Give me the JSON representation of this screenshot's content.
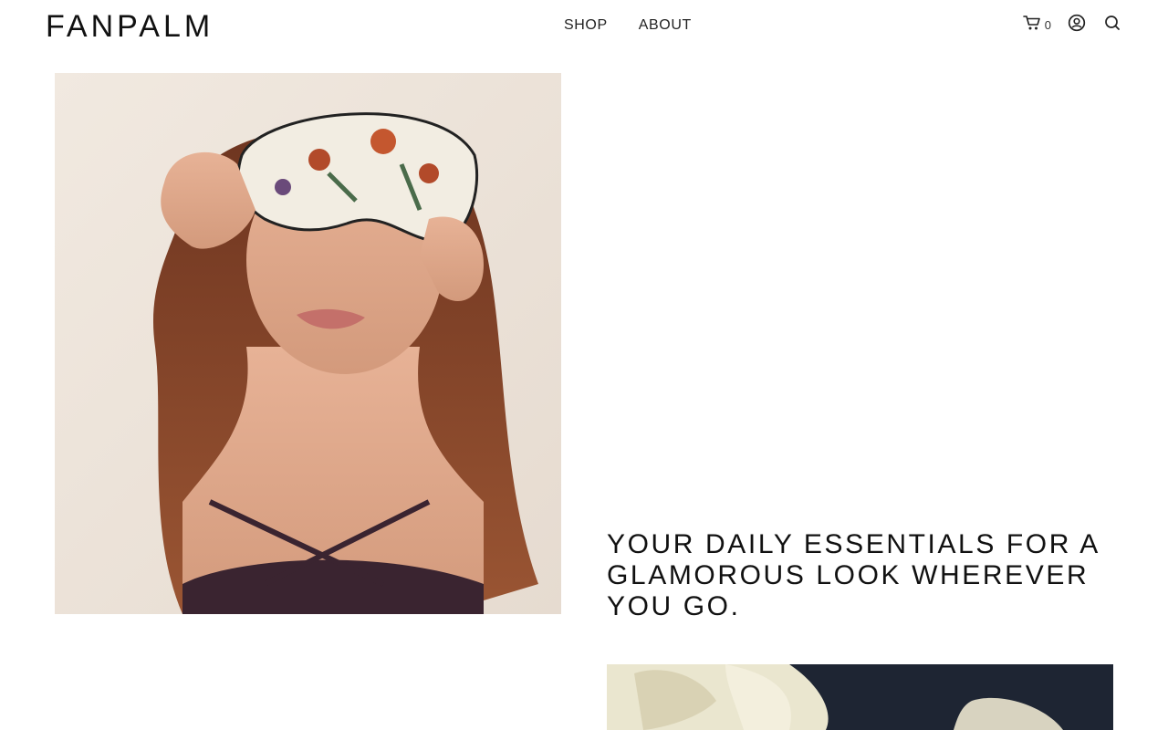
{
  "header": {
    "logo": "FANPALM",
    "nav": [
      {
        "label": "SHOP"
      },
      {
        "label": "ABOUT"
      }
    ],
    "cart_count": "0",
    "icons": [
      "cart-icon",
      "account-icon",
      "search-icon"
    ]
  },
  "hero": {
    "tagline": "YOUR DAILY ESSENTIALS FOR A GLAMOROUS LOOK WHEREVER YOU GO."
  },
  "colors": {
    "text": "#111111",
    "hero_background": "#efe6dd",
    "hair": "#8a4a2a",
    "second_image_dark": "#1e2533",
    "flower_cream": "#eae6cf"
  }
}
